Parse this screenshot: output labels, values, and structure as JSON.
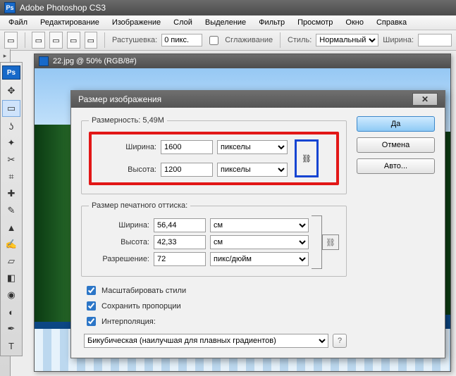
{
  "app": {
    "title": "Adobe Photoshop CS3"
  },
  "menu": {
    "file": "Файл",
    "edit": "Редактирование",
    "image": "Изображение",
    "layer": "Слой",
    "select": "Выделение",
    "filter": "Фильтр",
    "view": "Просмотр",
    "window": "Окно",
    "help": "Справка"
  },
  "optbar": {
    "feather_label": "Растушевка:",
    "feather_value": "0 пикс.",
    "antialias_label": "Сглаживание",
    "style_label": "Стиль:",
    "style_value": "Нормальный",
    "width_label": "Ширина:",
    "width_value": ""
  },
  "doc": {
    "title": "22.jpg @ 50% (RGB/8#)"
  },
  "dialog": {
    "title": "Размер изображения",
    "ok": "Да",
    "cancel": "Отмена",
    "auto": "Авто...",
    "dimensions_legend": "Размерность:",
    "dimensions_value": "5,49M",
    "pixel": {
      "width_label": "Ширина:",
      "width_value": "1600",
      "height_label": "Высота:",
      "height_value": "1200",
      "unit": "пикселы"
    },
    "print_legend": "Размер печатного оттиска:",
    "print": {
      "width_label": "Ширина:",
      "width_value": "56,44",
      "height_label": "Высота:",
      "height_value": "42,33",
      "unit": "см",
      "res_label": "Разрешение:",
      "res_value": "72",
      "res_unit": "пикс/дюйм"
    },
    "chk_scale": "Масштабировать стили",
    "chk_constrain": "Сохранить пропорции",
    "chk_resample": "Интерполяция:",
    "interp_value": "Бикубическая (наилучшая для плавных градиентов)"
  },
  "tools": [
    "move",
    "marquee",
    "lasso",
    "wand",
    "crop",
    "slice",
    "heal",
    "brush",
    "stamp",
    "history",
    "eraser",
    "gradient",
    "blur",
    "dodge",
    "pen",
    "type"
  ]
}
